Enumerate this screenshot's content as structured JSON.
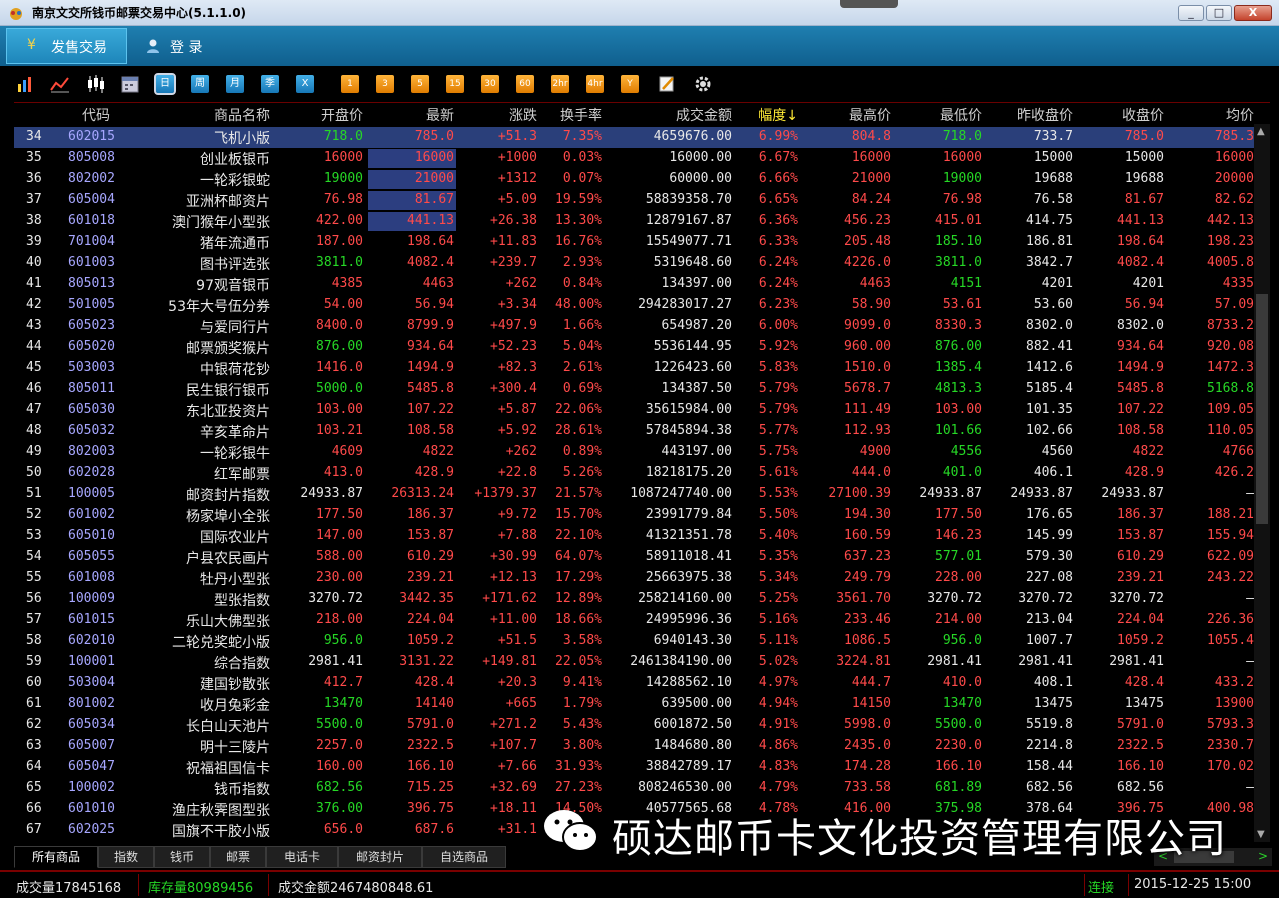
{
  "window": {
    "title": "南京文交所钱币邮票交易中心(5.1.1.0)",
    "buttons": [
      "_",
      "□",
      "X"
    ]
  },
  "menu": {
    "active_icon": "¥",
    "active_label": "发售交易",
    "login_label": "登  录"
  },
  "toolbar": {
    "periods": [
      "日",
      "周",
      "月",
      "季",
      "X"
    ],
    "minutes": [
      "1",
      "3",
      "5",
      "15",
      "30",
      "60",
      "2hr",
      "4hr",
      "Y"
    ]
  },
  "columns": [
    "代码",
    "商品名称",
    "开盘价",
    "最新",
    "涨跌",
    "换手率",
    "成交金额",
    "幅度↓",
    "最高价",
    "最低价",
    "昨收盘价",
    "收盘价",
    "均价"
  ],
  "rows": [
    {
      "no": "34",
      "code": "602015",
      "name": "飞机小版",
      "open": "718.0",
      "last": "785.0",
      "chg": "+51.3",
      "turn": "7.35%",
      "amount": "4659676.00",
      "amp": "6.99%",
      "high": "804.8",
      "low": "718.0",
      "prev": "733.7",
      "close": "785.0",
      "avg": "785.3",
      "oc": "g",
      "hc": "r",
      "lc": "g",
      "cc": "r",
      "ac": "r"
    },
    {
      "no": "35",
      "code": "805008",
      "name": "创业板银币",
      "open": "16000",
      "last": "16000",
      "chg": "+1000",
      "turn": "0.03%",
      "amount": "16000.00",
      "amp": "6.67%",
      "high": "16000",
      "low": "16000",
      "prev": "15000",
      "close": "15000",
      "avg": "16000",
      "oc": "r",
      "hc": "r",
      "lc": "r",
      "cc": "w",
      "ac": "r"
    },
    {
      "no": "36",
      "code": "802002",
      "name": "一轮彩银蛇",
      "open": "19000",
      "last": "21000",
      "chg": "+1312",
      "turn": "0.07%",
      "amount": "60000.00",
      "amp": "6.66%",
      "high": "21000",
      "low": "19000",
      "prev": "19688",
      "close": "19688",
      "avg": "20000",
      "oc": "g",
      "hc": "r",
      "lc": "g",
      "cc": "w",
      "ac": "r"
    },
    {
      "no": "37",
      "code": "605004",
      "name": "亚洲杯邮资片",
      "open": "76.98",
      "last": "81.67",
      "chg": "+5.09",
      "turn": "19.59%",
      "amount": "58839358.70",
      "amp": "6.65%",
      "high": "84.24",
      "low": "76.98",
      "prev": "76.58",
      "close": "81.67",
      "avg": "82.62",
      "oc": "r",
      "hc": "r",
      "lc": "r",
      "cc": "r",
      "ac": "r"
    },
    {
      "no": "38",
      "code": "601018",
      "name": "澳门猴年小型张",
      "open": "422.00",
      "last": "441.13",
      "chg": "+26.38",
      "turn": "13.30%",
      "amount": "12879167.87",
      "amp": "6.36%",
      "high": "456.23",
      "low": "415.01",
      "prev": "414.75",
      "close": "441.13",
      "avg": "442.13",
      "oc": "r",
      "hc": "r",
      "lc": "r",
      "cc": "r",
      "ac": "r"
    },
    {
      "no": "39",
      "code": "701004",
      "name": "猪年流通币",
      "open": "187.00",
      "last": "198.64",
      "chg": "+11.83",
      "turn": "16.76%",
      "amount": "15549077.71",
      "amp": "6.33%",
      "high": "205.48",
      "low": "185.10",
      "prev": "186.81",
      "close": "198.64",
      "avg": "198.23",
      "oc": "r",
      "hc": "r",
      "lc": "g",
      "cc": "r",
      "ac": "r"
    },
    {
      "no": "40",
      "code": "601003",
      "name": "图书评选张",
      "open": "3811.0",
      "last": "4082.4",
      "chg": "+239.7",
      "turn": "2.93%",
      "amount": "5319648.60",
      "amp": "6.24%",
      "high": "4226.0",
      "low": "3811.0",
      "prev": "3842.7",
      "close": "4082.4",
      "avg": "4005.8",
      "oc": "g",
      "hc": "r",
      "lc": "g",
      "cc": "r",
      "ac": "r"
    },
    {
      "no": "41",
      "code": "805013",
      "name": "97观音银币",
      "open": "4385",
      "last": "4463",
      "chg": "+262",
      "turn": "0.84%",
      "amount": "134397.00",
      "amp": "6.24%",
      "high": "4463",
      "low": "4151",
      "prev": "4201",
      "close": "4201",
      "avg": "4335",
      "oc": "r",
      "hc": "r",
      "lc": "g",
      "cc": "w",
      "ac": "r"
    },
    {
      "no": "42",
      "code": "501005",
      "name": "53年大号伍分券",
      "open": "54.00",
      "last": "56.94",
      "chg": "+3.34",
      "turn": "48.00%",
      "amount": "294283017.27",
      "amp": "6.23%",
      "high": "58.90",
      "low": "53.61",
      "prev": "53.60",
      "close": "56.94",
      "avg": "57.09",
      "oc": "r",
      "hc": "r",
      "lc": "r",
      "cc": "r",
      "ac": "r"
    },
    {
      "no": "43",
      "code": "605023",
      "name": "与爱同行片",
      "open": "8400.0",
      "last": "8799.9",
      "chg": "+497.9",
      "turn": "1.66%",
      "amount": "654987.20",
      "amp": "6.00%",
      "high": "9099.0",
      "low": "8330.3",
      "prev": "8302.0",
      "close": "8302.0",
      "avg": "8733.2",
      "oc": "r",
      "hc": "r",
      "lc": "r",
      "cc": "w",
      "ac": "r"
    },
    {
      "no": "44",
      "code": "605020",
      "name": "邮票颁奖猴片",
      "open": "876.00",
      "last": "934.64",
      "chg": "+52.23",
      "turn": "5.04%",
      "amount": "5536144.95",
      "amp": "5.92%",
      "high": "960.00",
      "low": "876.00",
      "prev": "882.41",
      "close": "934.64",
      "avg": "920.08",
      "oc": "g",
      "hc": "r",
      "lc": "g",
      "cc": "r",
      "ac": "r"
    },
    {
      "no": "45",
      "code": "503003",
      "name": "中银荷花钞",
      "open": "1416.0",
      "last": "1494.9",
      "chg": "+82.3",
      "turn": "2.61%",
      "amount": "1226423.60",
      "amp": "5.83%",
      "high": "1510.0",
      "low": "1385.4",
      "prev": "1412.6",
      "close": "1494.9",
      "avg": "1472.3",
      "oc": "r",
      "hc": "r",
      "lc": "g",
      "cc": "r",
      "ac": "r"
    },
    {
      "no": "46",
      "code": "805011",
      "name": "民生银行银币",
      "open": "5000.0",
      "last": "5485.8",
      "chg": "+300.4",
      "turn": "0.69%",
      "amount": "134387.50",
      "amp": "5.79%",
      "high": "5678.7",
      "low": "4813.3",
      "prev": "5185.4",
      "close": "5485.8",
      "avg": "5168.8",
      "oc": "g",
      "hc": "r",
      "lc": "g",
      "cc": "r",
      "ac": "g"
    },
    {
      "no": "47",
      "code": "605030",
      "name": "东北亚投资片",
      "open": "103.00",
      "last": "107.22",
      "chg": "+5.87",
      "turn": "22.06%",
      "amount": "35615984.00",
      "amp": "5.79%",
      "high": "111.49",
      "low": "103.00",
      "prev": "101.35",
      "close": "107.22",
      "avg": "109.05",
      "oc": "r",
      "hc": "r",
      "lc": "r",
      "cc": "r",
      "ac": "r"
    },
    {
      "no": "48",
      "code": "605032",
      "name": "辛亥革命片",
      "open": "103.21",
      "last": "108.58",
      "chg": "+5.92",
      "turn": "28.61%",
      "amount": "57845894.38",
      "amp": "5.77%",
      "high": "112.93",
      "low": "101.66",
      "prev": "102.66",
      "close": "108.58",
      "avg": "110.05",
      "oc": "r",
      "hc": "r",
      "lc": "g",
      "cc": "r",
      "ac": "r"
    },
    {
      "no": "49",
      "code": "802003",
      "name": "一轮彩银牛",
      "open": "4609",
      "last": "4822",
      "chg": "+262",
      "turn": "0.89%",
      "amount": "443197.00",
      "amp": "5.75%",
      "high": "4900",
      "low": "4556",
      "prev": "4560",
      "close": "4822",
      "avg": "4766",
      "oc": "r",
      "hc": "r",
      "lc": "g",
      "cc": "r",
      "ac": "r"
    },
    {
      "no": "50",
      "code": "602028",
      "name": "红军邮票",
      "open": "413.0",
      "last": "428.9",
      "chg": "+22.8",
      "turn": "5.26%",
      "amount": "18218175.20",
      "amp": "5.61%",
      "high": "444.0",
      "low": "401.0",
      "prev": "406.1",
      "close": "428.9",
      "avg": "426.2",
      "oc": "r",
      "hc": "r",
      "lc": "g",
      "cc": "r",
      "ac": "r"
    },
    {
      "no": "51",
      "code": "100005",
      "name": "邮资封片指数",
      "open": "24933.87",
      "last": "26313.24",
      "chg": "+1379.37",
      "turn": "21.57%",
      "amount": "1087247740.00",
      "amp": "5.53%",
      "high": "27100.39",
      "low": "24933.87",
      "prev": "24933.87",
      "close": "24933.87",
      "avg": "—",
      "oc": "w",
      "hc": "r",
      "lc": "w",
      "cc": "w",
      "ac": "w"
    },
    {
      "no": "52",
      "code": "601002",
      "name": "杨家埠小全张",
      "open": "177.50",
      "last": "186.37",
      "chg": "+9.72",
      "turn": "15.70%",
      "amount": "23991779.84",
      "amp": "5.50%",
      "high": "194.30",
      "low": "177.50",
      "prev": "176.65",
      "close": "186.37",
      "avg": "188.21",
      "oc": "r",
      "hc": "r",
      "lc": "r",
      "cc": "r",
      "ac": "r"
    },
    {
      "no": "53",
      "code": "605010",
      "name": "国际农业片",
      "open": "147.00",
      "last": "153.87",
      "chg": "+7.88",
      "turn": "22.10%",
      "amount": "41321351.78",
      "amp": "5.40%",
      "high": "160.59",
      "low": "146.23",
      "prev": "145.99",
      "close": "153.87",
      "avg": "155.94",
      "oc": "r",
      "hc": "r",
      "lc": "r",
      "cc": "r",
      "ac": "r"
    },
    {
      "no": "54",
      "code": "605055",
      "name": "户县农民画片",
      "open": "588.00",
      "last": "610.29",
      "chg": "+30.99",
      "turn": "64.07%",
      "amount": "58911018.41",
      "amp": "5.35%",
      "high": "637.23",
      "low": "577.01",
      "prev": "579.30",
      "close": "610.29",
      "avg": "622.09",
      "oc": "r",
      "hc": "r",
      "lc": "g",
      "cc": "r",
      "ac": "r"
    },
    {
      "no": "55",
      "code": "601008",
      "name": "牡丹小型张",
      "open": "230.00",
      "last": "239.21",
      "chg": "+12.13",
      "turn": "17.29%",
      "amount": "25663975.38",
      "amp": "5.34%",
      "high": "249.79",
      "low": "228.00",
      "prev": "227.08",
      "close": "239.21",
      "avg": "243.22",
      "oc": "r",
      "hc": "r",
      "lc": "r",
      "cc": "r",
      "ac": "r"
    },
    {
      "no": "56",
      "code": "100009",
      "name": "型张指数",
      "open": "3270.72",
      "last": "3442.35",
      "chg": "+171.62",
      "turn": "12.89%",
      "amount": "258214160.00",
      "amp": "5.25%",
      "high": "3561.70",
      "low": "3270.72",
      "prev": "3270.72",
      "close": "3270.72",
      "avg": "—",
      "oc": "w",
      "hc": "r",
      "lc": "w",
      "cc": "w",
      "ac": "w"
    },
    {
      "no": "57",
      "code": "601015",
      "name": "乐山大佛型张",
      "open": "218.00",
      "last": "224.04",
      "chg": "+11.00",
      "turn": "18.66%",
      "amount": "24995996.36",
      "amp": "5.16%",
      "high": "233.46",
      "low": "214.00",
      "prev": "213.04",
      "close": "224.04",
      "avg": "226.36",
      "oc": "r",
      "hc": "r",
      "lc": "r",
      "cc": "r",
      "ac": "r"
    },
    {
      "no": "58",
      "code": "602010",
      "name": "二轮兑奖蛇小版",
      "open": "956.0",
      "last": "1059.2",
      "chg": "+51.5",
      "turn": "3.58%",
      "amount": "6940143.30",
      "amp": "5.11%",
      "high": "1086.5",
      "low": "956.0",
      "prev": "1007.7",
      "close": "1059.2",
      "avg": "1055.4",
      "oc": "g",
      "hc": "r",
      "lc": "g",
      "cc": "r",
      "ac": "r"
    },
    {
      "no": "59",
      "code": "100001",
      "name": "综合指数",
      "open": "2981.41",
      "last": "3131.22",
      "chg": "+149.81",
      "turn": "22.05%",
      "amount": "2461384190.00",
      "amp": "5.02%",
      "high": "3224.81",
      "low": "2981.41",
      "prev": "2981.41",
      "close": "2981.41",
      "avg": "—",
      "oc": "w",
      "hc": "r",
      "lc": "w",
      "cc": "w",
      "ac": "w"
    },
    {
      "no": "60",
      "code": "503004",
      "name": "建国钞散张",
      "open": "412.7",
      "last": "428.4",
      "chg": "+20.3",
      "turn": "9.41%",
      "amount": "14288562.10",
      "amp": "4.97%",
      "high": "444.7",
      "low": "410.0",
      "prev": "408.1",
      "close": "428.4",
      "avg": "433.2",
      "oc": "r",
      "hc": "r",
      "lc": "r",
      "cc": "r",
      "ac": "r"
    },
    {
      "no": "61",
      "code": "801002",
      "name": "收月兔彩金",
      "open": "13470",
      "last": "14140",
      "chg": "+665",
      "turn": "1.79%",
      "amount": "639500.00",
      "amp": "4.94%",
      "high": "14150",
      "low": "13470",
      "prev": "13475",
      "close": "13475",
      "avg": "13900",
      "oc": "g",
      "hc": "r",
      "lc": "g",
      "cc": "w",
      "ac": "r"
    },
    {
      "no": "62",
      "code": "605034",
      "name": "长白山天池片",
      "open": "5500.0",
      "last": "5791.0",
      "chg": "+271.2",
      "turn": "5.43%",
      "amount": "6001872.50",
      "amp": "4.91%",
      "high": "5998.0",
      "low": "5500.0",
      "prev": "5519.8",
      "close": "5791.0",
      "avg": "5793.3",
      "oc": "g",
      "hc": "r",
      "lc": "g",
      "cc": "r",
      "ac": "r"
    },
    {
      "no": "63",
      "code": "605007",
      "name": "明十三陵片",
      "open": "2257.0",
      "last": "2322.5",
      "chg": "+107.7",
      "turn": "3.80%",
      "amount": "1484680.80",
      "amp": "4.86%",
      "high": "2435.0",
      "low": "2230.0",
      "prev": "2214.8",
      "close": "2322.5",
      "avg": "2330.7",
      "oc": "r",
      "hc": "r",
      "lc": "r",
      "cc": "r",
      "ac": "r"
    },
    {
      "no": "64",
      "code": "605047",
      "name": "祝福祖国信卡",
      "open": "160.00",
      "last": "166.10",
      "chg": "+7.66",
      "turn": "31.93%",
      "amount": "38842789.17",
      "amp": "4.83%",
      "high": "174.28",
      "low": "166.10",
      "prev": "158.44",
      "close": "166.10",
      "avg": "170.02",
      "oc": "r",
      "hc": "r",
      "lc": "r",
      "cc": "r",
      "ac": "r"
    },
    {
      "no": "65",
      "code": "100002",
      "name": "钱币指数",
      "open": "682.56",
      "last": "715.25",
      "chg": "+32.69",
      "turn": "27.23%",
      "amount": "808246530.00",
      "amp": "4.79%",
      "high": "733.58",
      "low": "681.89",
      "prev": "682.56",
      "close": "682.56",
      "avg": "—",
      "oc": "g",
      "hc": "r",
      "lc": "g",
      "cc": "w",
      "ac": "w"
    },
    {
      "no": "66",
      "code": "601010",
      "name": "渔庄秋霁图型张",
      "open": "376.00",
      "last": "396.75",
      "chg": "+18.11",
      "turn": "14.50%",
      "amount": "40577565.68",
      "amp": "4.78%",
      "high": "416.00",
      "low": "375.98",
      "prev": "378.64",
      "close": "396.75",
      "avg": "400.98",
      "oc": "g",
      "hc": "r",
      "lc": "g",
      "cc": "r",
      "ac": "r"
    },
    {
      "no": "67",
      "code": "602025",
      "name": "国旗不干胶小版",
      "open": "656.0",
      "last": "687.6",
      "chg": "+31.1",
      "turn": "",
      "amount": "",
      "amp": "",
      "high": "",
      "low": "",
      "prev": "",
      "close": "",
      "avg": "",
      "oc": "r",
      "hc": "r",
      "lc": "r",
      "cc": "r",
      "ac": "r"
    }
  ],
  "tabs": [
    "所有商品",
    "指数",
    "钱币",
    "邮票",
    "电话卡",
    "邮资封片",
    "自选商品"
  ],
  "status": {
    "volume": "成交量17845168",
    "stock": "库存量80989456",
    "amount": "成交金额2467480848.61",
    "connection": "连接",
    "datetime": "2015-12-25 15:00"
  },
  "watermark": "硕达邮币卡文化投资管理有限公司",
  "colors": {
    "up": "#ff4a4a",
    "down": "#26d826",
    "flat": "#e8e8e8",
    "code": "#a7a7ff"
  }
}
